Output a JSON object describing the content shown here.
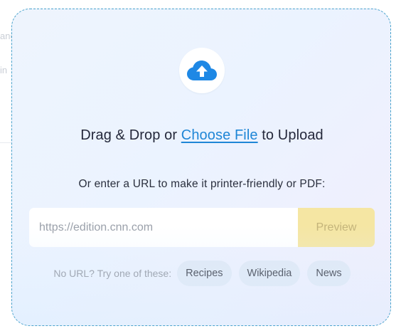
{
  "background": {
    "fragment_1": "ance.",
    "fragment_2": "in"
  },
  "dropzone": {
    "icon": "cloud-upload-icon",
    "headline_prefix": "Drag & Drop or ",
    "headline_link": "Choose File",
    "headline_suffix": " to Upload",
    "url_prompt": "Or enter a URL to make it printer-friendly or PDF:",
    "url_input": {
      "value": "",
      "placeholder": "https://edition.cnn.com"
    },
    "preview_label": "Preview",
    "examples_label": "No URL? Try one of these:",
    "examples": [
      "Recipes",
      "Wikipedia",
      "News"
    ]
  },
  "colors": {
    "accent_link": "#1f86d6",
    "icon_blue": "#1e88e5",
    "preview_button_bg": "#f5e6a3",
    "dashed_border": "#4aa3cc"
  }
}
